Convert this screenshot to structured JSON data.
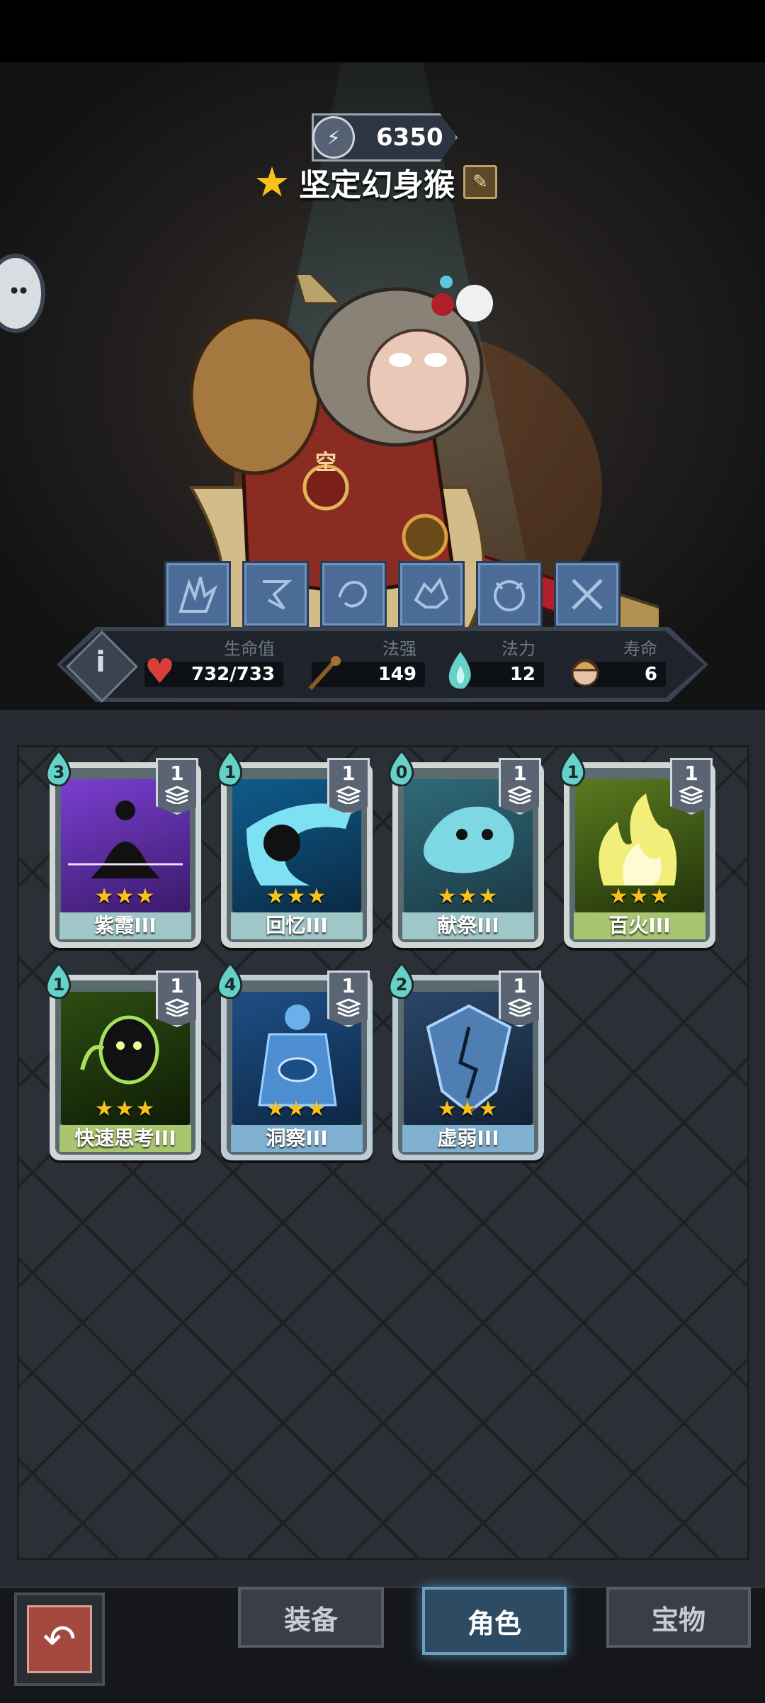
{
  "hero": {
    "power": "6350",
    "name": "坚定幻身猴",
    "badge": "空"
  },
  "stats": [
    {
      "label": "生命值",
      "value": "732/733",
      "icon": "heart-icon"
    },
    {
      "label": "法强",
      "value": "149",
      "icon": "staff-icon"
    },
    {
      "label": "法力",
      "value": "12",
      "icon": "mana-flame-icon"
    },
    {
      "label": "寿命",
      "value": "6",
      "icon": "character-portrait-icon"
    }
  ],
  "cards": [
    {
      "name": "紫霞III",
      "cost": "3",
      "level": "1",
      "stars": "★★★"
    },
    {
      "name": "回忆III",
      "cost": "1",
      "level": "1",
      "stars": "★★★"
    },
    {
      "name": "献祭III",
      "cost": "0",
      "level": "1",
      "stars": "★★★"
    },
    {
      "name": "百火III",
      "cost": "1",
      "level": "1",
      "stars": "★★★"
    },
    {
      "name": "快速思考III",
      "cost": "1",
      "level": "1",
      "stars": "★★★"
    },
    {
      "name": "洞察III",
      "cost": "4",
      "level": "1",
      "stars": "★★★"
    },
    {
      "name": "虚弱III",
      "cost": "2",
      "level": "1",
      "stars": "★★★"
    }
  ],
  "tabs": {
    "equipment": "装备",
    "character": "角色",
    "treasure": "宝物"
  },
  "colors": {
    "star": "#f7c21d",
    "active_tab": "#2d4c63"
  }
}
